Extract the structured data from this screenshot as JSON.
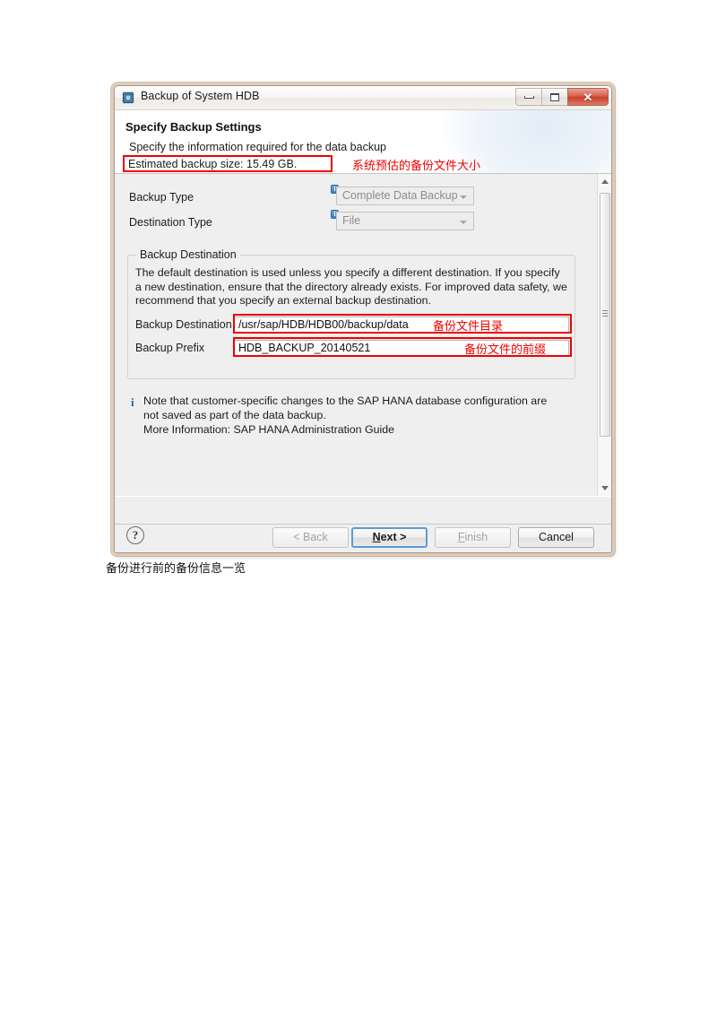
{
  "window": {
    "title": "Backup of System HDB",
    "icon": "system-chip-icon",
    "controls": {
      "minimize": "minimize-icon",
      "maximize": "maximize-icon",
      "close": "✕"
    }
  },
  "wizard": {
    "heading": "Specify Backup Settings",
    "subtitle": "Specify the information required for the data backup",
    "estimated_size": "Estimated backup size: 15.49 GB.",
    "annotation_size": "系统预估的备份文件大小"
  },
  "form": {
    "backup_type": {
      "label": "Backup Type",
      "value": "Complete Data Backup",
      "info_icon": "i",
      "disabled": true
    },
    "destination_type": {
      "label": "Destination Type",
      "value": "File",
      "info_icon": "i",
      "disabled": true
    }
  },
  "backup_destination": {
    "group_title": "Backup Destination",
    "description": "The default destination is used unless you specify a different destination. If you specify a new destination, ensure that the directory already exists. For improved data safety, we recommend that you specify an external backup destination.",
    "destination": {
      "label": "Backup Destination",
      "value": "/usr/sap/HDB/HDB00/backup/data",
      "annotation": "备份文件目录"
    },
    "prefix": {
      "label": "Backup Prefix",
      "value": "HDB_BACKUP_20140521",
      "annotation": "备份文件的前缀"
    }
  },
  "note": {
    "icon": "i",
    "line1": "Note that customer-specific changes to the SAP HANA database configuration are",
    "line2": "not saved as part of the data backup.",
    "line3": "More Information: SAP HANA Administration Guide"
  },
  "scrollbar": {
    "up_icon": "scroll-up-icon",
    "down_icon": "scroll-down-icon"
  },
  "footer": {
    "help": "?",
    "back": "< Back",
    "next_pre": "N",
    "next_post": "ext >",
    "finish_pre": "F",
    "finish_post": "inish",
    "cancel": "Cancel"
  },
  "page": {
    "caption": "备份进行前的备份信息一览"
  },
  "colors": {
    "annotation_red": "#ee0000",
    "default_button_focus": "#5b9bd5",
    "info_blue": "#2a63ad"
  }
}
